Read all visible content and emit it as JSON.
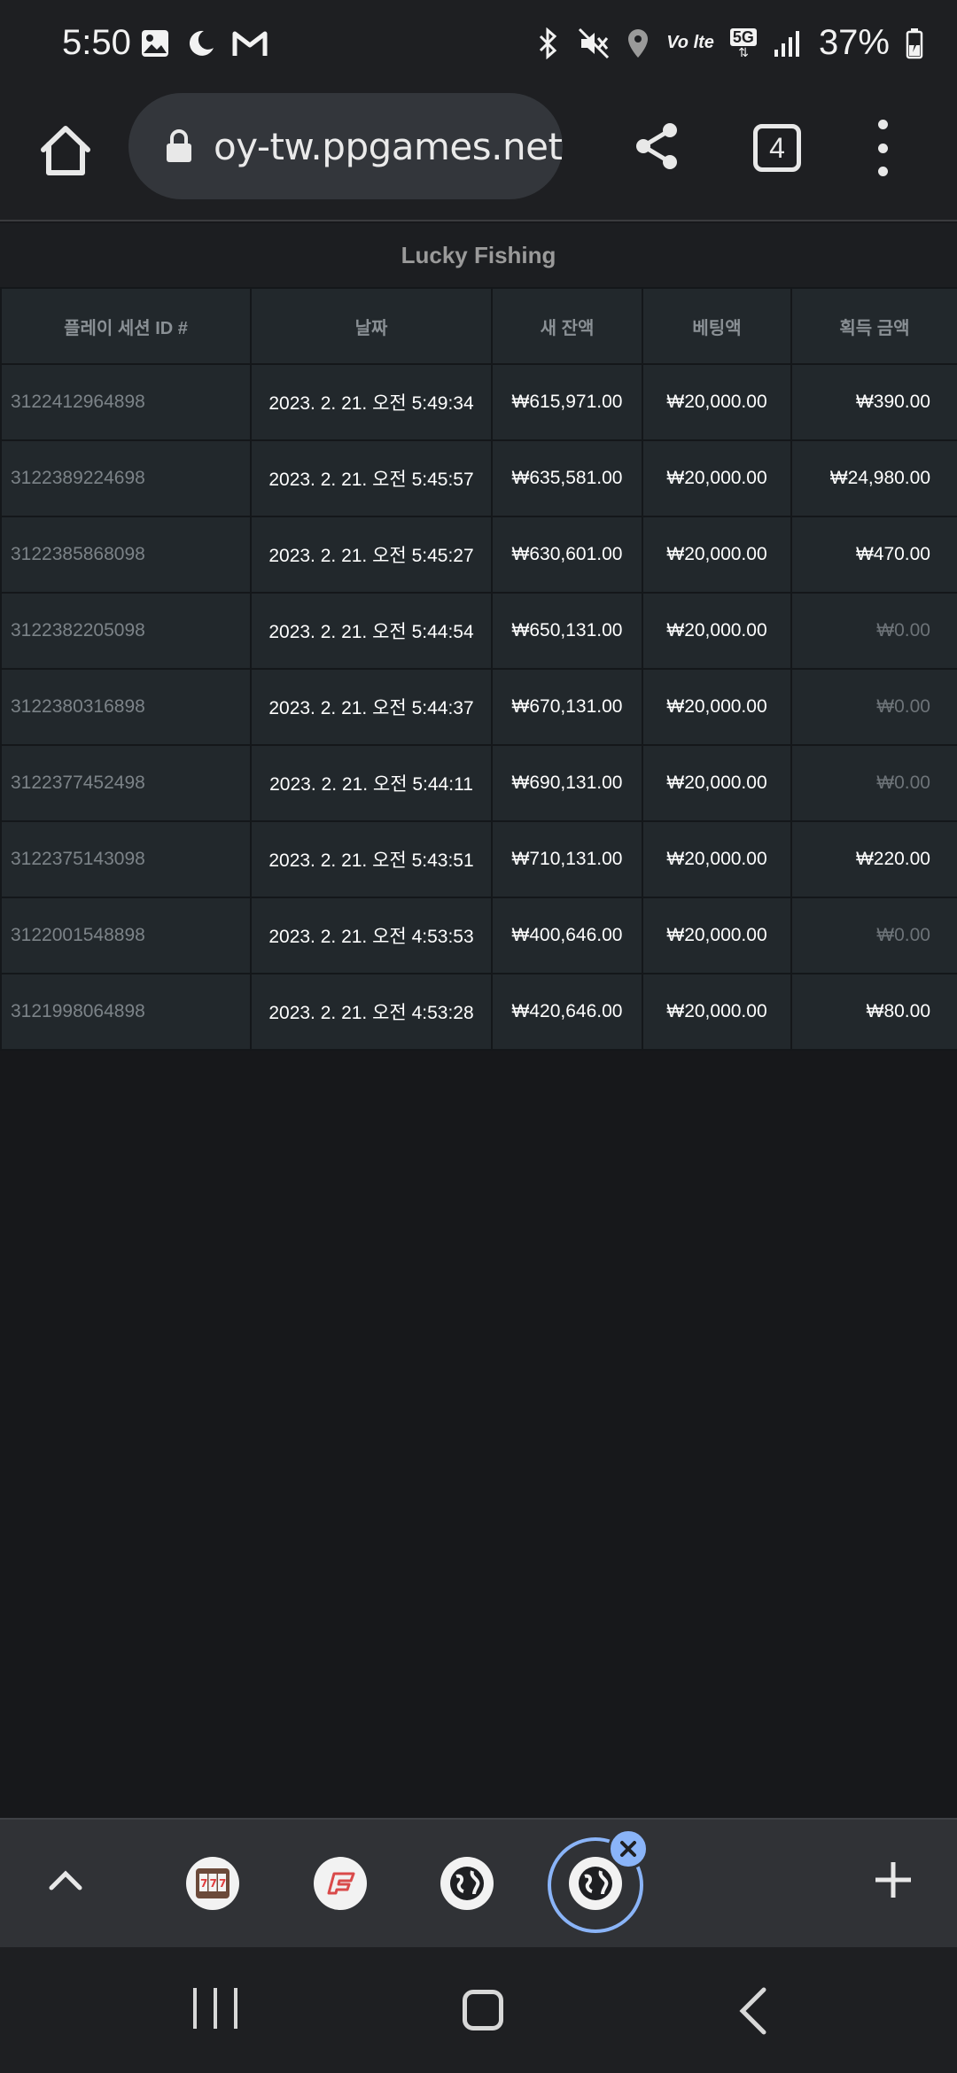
{
  "status_bar": {
    "time": "5:50",
    "battery": "37%",
    "left_icons": [
      "gallery-icon",
      "moon-icon",
      "gmail-icon"
    ],
    "right_icons": [
      "bluetooth-icon",
      "mute-icon",
      "location-icon",
      "volte-icon",
      "5g-icon",
      "signal-icon",
      "battery-icon"
    ],
    "volte_label": "Vo lte",
    "network_label": "5G"
  },
  "browser": {
    "url": "oy-tw.ppgames.net",
    "tab_count": "4"
  },
  "page": {
    "title": "Lucky Fishing",
    "columns": [
      "플레이 세션 ID #",
      "날짜",
      "새 잔액",
      "베팅액",
      "획득 금액"
    ],
    "rows": [
      {
        "id": "3122412964898",
        "date": "2023. 2. 21. 오전 5:49:34",
        "balance": "₩615,971.00",
        "bet": "₩20,000.00",
        "win": "₩390.00"
      },
      {
        "id": "3122389224698",
        "date": "2023. 2. 21. 오전 5:45:57",
        "balance": "₩635,581.00",
        "bet": "₩20,000.00",
        "win": "₩24,980.00"
      },
      {
        "id": "3122385868098",
        "date": "2023. 2. 21. 오전 5:45:27",
        "balance": "₩630,601.00",
        "bet": "₩20,000.00",
        "win": "₩470.00"
      },
      {
        "id": "3122382205098",
        "date": "2023. 2. 21. 오전 5:44:54",
        "balance": "₩650,131.00",
        "bet": "₩20,000.00",
        "win": "₩0.00"
      },
      {
        "id": "3122380316898",
        "date": "2023. 2. 21. 오전 5:44:37",
        "balance": "₩670,131.00",
        "bet": "₩20,000.00",
        "win": "₩0.00"
      },
      {
        "id": "3122377452498",
        "date": "2023. 2. 21. 오전 5:44:11",
        "balance": "₩690,131.00",
        "bet": "₩20,000.00",
        "win": "₩0.00"
      },
      {
        "id": "3122375143098",
        "date": "2023. 2. 21. 오전 5:43:51",
        "balance": "₩710,131.00",
        "bet": "₩20,000.00",
        "win": "₩220.00"
      },
      {
        "id": "3122001548898",
        "date": "2023. 2. 21. 오전 4:53:53",
        "balance": "₩400,646.00",
        "bet": "₩20,000.00",
        "win": "₩0.00"
      },
      {
        "id": "3121998064898",
        "date": "2023. 2. 21. 오전 4:53:28",
        "balance": "₩420,646.00",
        "bet": "₩20,000.00",
        "win": "₩80.00"
      }
    ]
  },
  "tab_strip": {
    "tabs": [
      "slot-machine-favicon",
      "ppgames-favicon",
      "globe-icon",
      "globe-icon"
    ],
    "active_index": 3
  },
  "colors": {
    "accent": "#8ab4f8",
    "page_bg": "#17181b",
    "table_bg": "#22282c"
  }
}
